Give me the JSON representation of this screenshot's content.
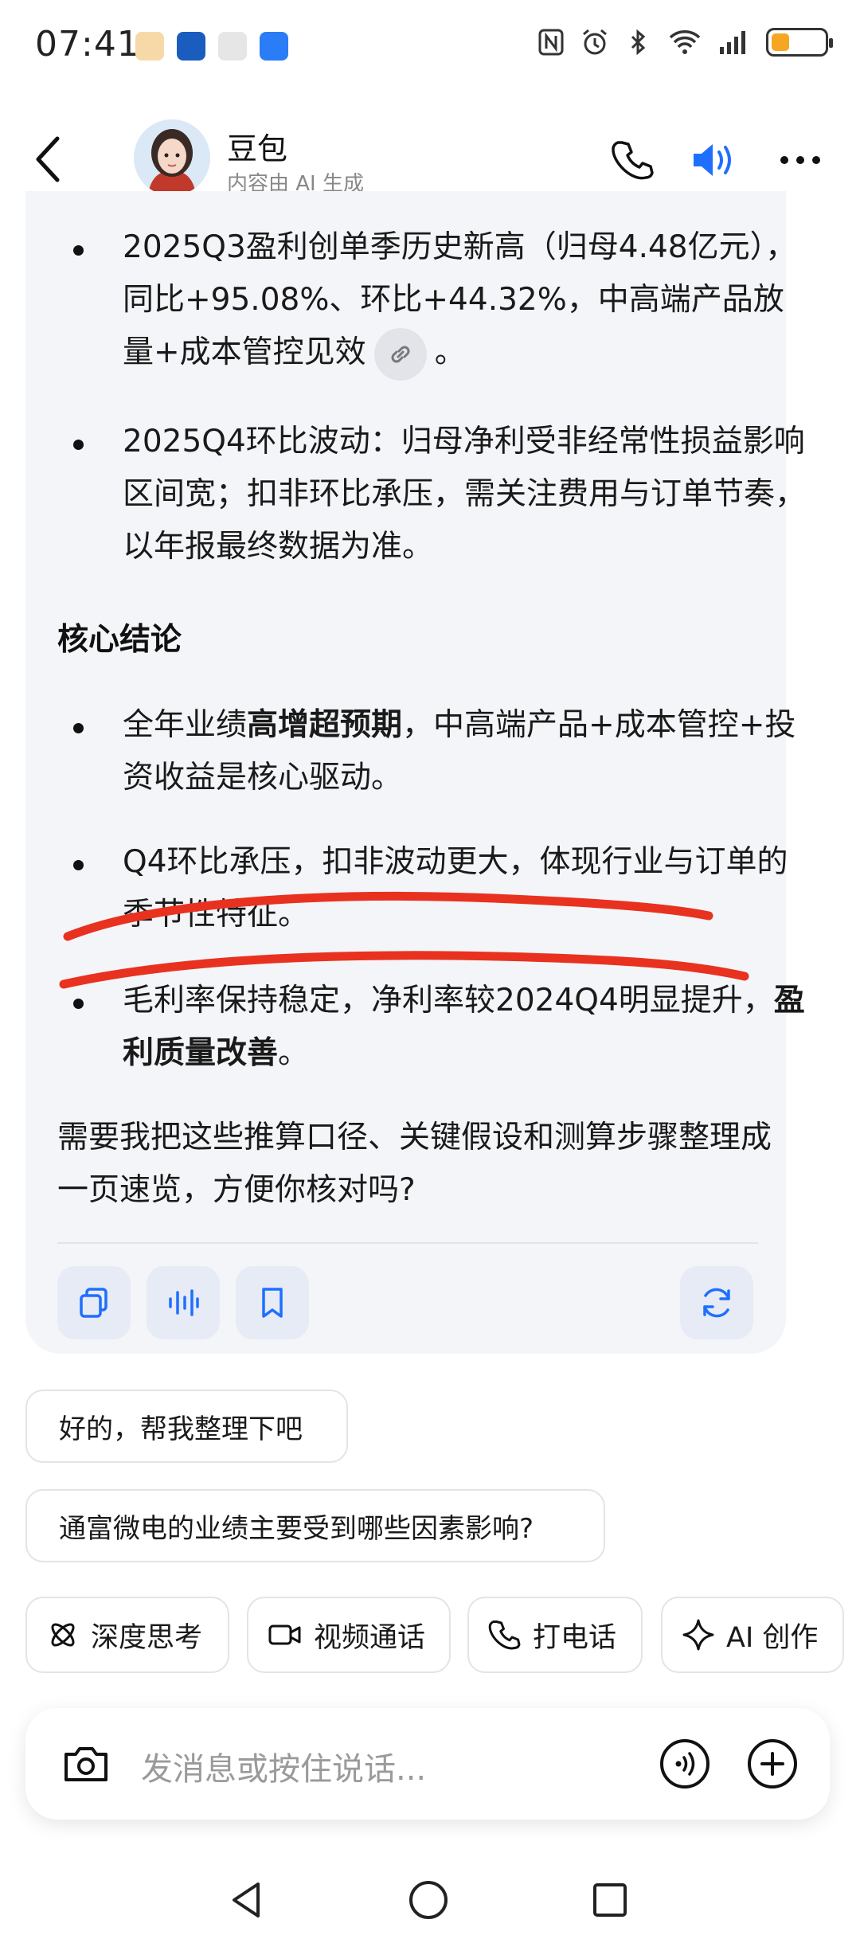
{
  "status_bar": {
    "time": "07:41"
  },
  "header": {
    "bot_name": "豆包",
    "bot_subtitle": "内容由 AI 生成"
  },
  "message": {
    "bullets_top": [
      {
        "parts": [
          {
            "text": "2025Q3盈利创单季历史新高（归母4.48亿元），同比+95.08%、环比+44.32%，中高端产品放量+成本管控见效",
            "bold": false
          }
        ],
        "has_link": true,
        "tail": "。"
      },
      {
        "parts": [
          {
            "text": "2025Q4环比波动：归母净利受非经常性损益影响区间宽；扣非环比承压，需关注费用与订单节奏，以年报最终数据为准。",
            "bold": false
          }
        ],
        "has_link": false,
        "tail": ""
      }
    ],
    "section_title": "核心结论",
    "conclusions": {
      "c1_a": "全年业绩",
      "c1_b": "高增超预期",
      "c1_c": "，中高端产品+成本管控+投资收益是核心驱动。",
      "c2": "Q4环比承压，扣非波动更大，体现行业与订单的季节性特征。",
      "c3_a": "毛利率保持稳定，净利率较2024Q4明显提升，",
      "c3_b": "盈利质量改善",
      "c3_c": "。"
    },
    "closing": "需要我把这些推算口径、关键假设和测算步骤整理成一页速览，方便你核对吗?",
    "action_icons": [
      "copy-icon",
      "voice-icon",
      "bookmark-icon",
      "regenerate-icon"
    ]
  },
  "suggestions": [
    "好的，帮我整理下吧",
    "通富微电的业绩主要受到哪些因素影响?"
  ],
  "quick_actions": [
    {
      "label": "深度思考",
      "icon": "atom-icon"
    },
    {
      "label": "视频通话",
      "icon": "video-icon"
    },
    {
      "label": "打电话",
      "icon": "phone-icon"
    },
    {
      "label": "AI 创作",
      "icon": "sparkle-icon"
    }
  ],
  "input": {
    "placeholder": "发消息或按住说话..."
  },
  "colors": {
    "accent": "#1f6fff",
    "card_bg": "#f4f5f8",
    "scribble": "#e8321f",
    "battery": "#f5a623"
  }
}
